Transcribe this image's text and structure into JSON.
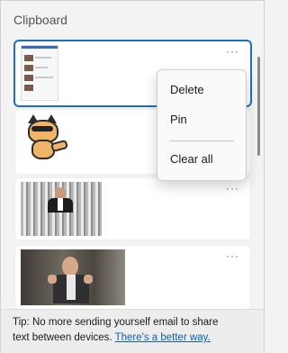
{
  "panel": {
    "title": "Clipboard"
  },
  "items": [
    {
      "type": "screenshot-thumbnail",
      "more_label": "···",
      "selected": true
    },
    {
      "type": "cat-sticker",
      "more_label": "···"
    },
    {
      "type": "gif-man-in-suit",
      "more_label": "···"
    },
    {
      "type": "gif-man-thumbs-up",
      "more_label": "···"
    }
  ],
  "context_menu": {
    "items": [
      "Delete",
      "Pin",
      "Clear all"
    ]
  },
  "tip": {
    "line1": "Tip: No more sending yourself email to share",
    "line2_prefix": "text between devices.",
    "link": "There's a better way."
  },
  "colors": {
    "accent": "#1a6fc4",
    "link": "#0c5fb5",
    "background": "#f3f3f3"
  }
}
